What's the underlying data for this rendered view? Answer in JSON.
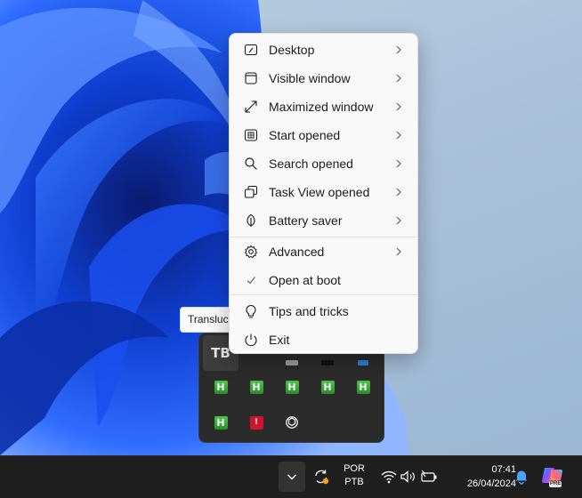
{
  "menu": {
    "items": [
      {
        "label": "Desktop",
        "icon": "desktop-icon",
        "submenu": true
      },
      {
        "label": "Visible window",
        "icon": "window-icon",
        "submenu": true
      },
      {
        "label": "Maximized window",
        "icon": "maximize-icon",
        "submenu": true
      },
      {
        "label": "Start opened",
        "icon": "start-icon",
        "submenu": true
      },
      {
        "label": "Search opened",
        "icon": "search-icon",
        "submenu": true
      },
      {
        "label": "Task View opened",
        "icon": "task-view-icon",
        "submenu": true
      },
      {
        "label": "Battery saver",
        "icon": "leaf-icon",
        "submenu": true
      },
      {
        "label": "Advanced",
        "icon": "gear-icon",
        "submenu": true
      },
      {
        "label": "Open at boot",
        "icon": "checkmark-icon",
        "checked": true
      },
      {
        "label": "Tips and tricks",
        "icon": "lightbulb-icon"
      },
      {
        "label": "Exit",
        "icon": "power-icon"
      }
    ]
  },
  "tooltip": {
    "text": "TranslucentTB"
  },
  "tray": {
    "icons": [
      "translucenttb-icon",
      "tray-app-icon",
      "tray-app-icon",
      "tray-app-icon",
      "tray-app-icon",
      "h-icon",
      "h-icon",
      "h-icon",
      "h-icon",
      "h-icon",
      "h-icon",
      "amd-icon",
      "openai-icon"
    ],
    "h_letter": "H"
  },
  "taskbar": {
    "language": "POR",
    "layout": "PTB",
    "time": "07:41",
    "date": "26/04/2024",
    "copilot_badge": "PRE"
  },
  "colors": {
    "menu_bg": "#f9f9f9",
    "tray_bg": "#2b2b2b",
    "taskbar_bg": "#1f1f1f",
    "accent": "#0067c0"
  }
}
